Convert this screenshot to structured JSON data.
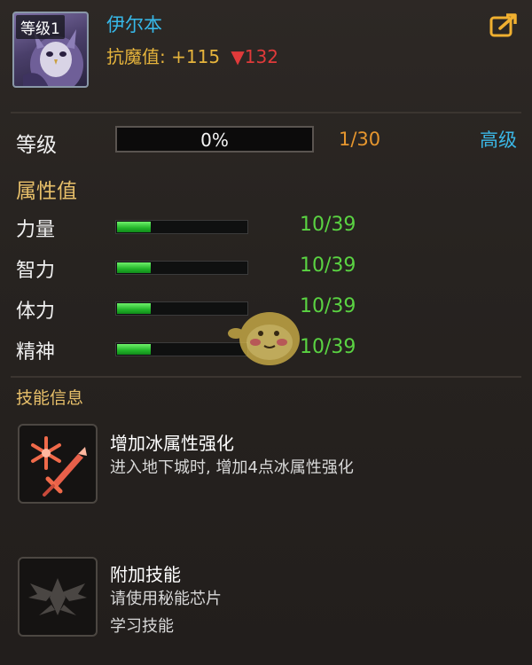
{
  "hero": {
    "level_tag": "等级1",
    "name": "伊尔本",
    "resist_label": "抗魔值:",
    "resist_value": "+115",
    "resist_delta": "▼132"
  },
  "level": {
    "label": "等级",
    "progress_text": "0%",
    "progress": 0,
    "count": "1/30",
    "advanced_label": "高级"
  },
  "attributes": {
    "title": "属性值",
    "items": [
      {
        "name": "力量",
        "value": "10/39",
        "progress": 0.26
      },
      {
        "name": "智力",
        "value": "10/39",
        "progress": 0.26
      },
      {
        "name": "体力",
        "value": "10/39",
        "progress": 0.26
      },
      {
        "name": "精神",
        "value": "10/39",
        "progress": 0.26
      }
    ]
  },
  "skills": {
    "title": "技能信息",
    "items": [
      {
        "icon": "ice-sword-icon",
        "name": "增加冰属性强化",
        "desc_lines": [
          "进入地下城时, 增加4点冰属性强化"
        ]
      },
      {
        "icon": "wing-emblem-icon",
        "name": "附加技能",
        "desc_lines": [
          "请使用秘能芯片",
          "学习技能"
        ]
      }
    ]
  },
  "colors": {
    "name_blue": "#37b8e8",
    "gold": "#e6b43c",
    "red": "#e03a3a",
    "green": "#5ad342",
    "orange": "#e6962e"
  }
}
